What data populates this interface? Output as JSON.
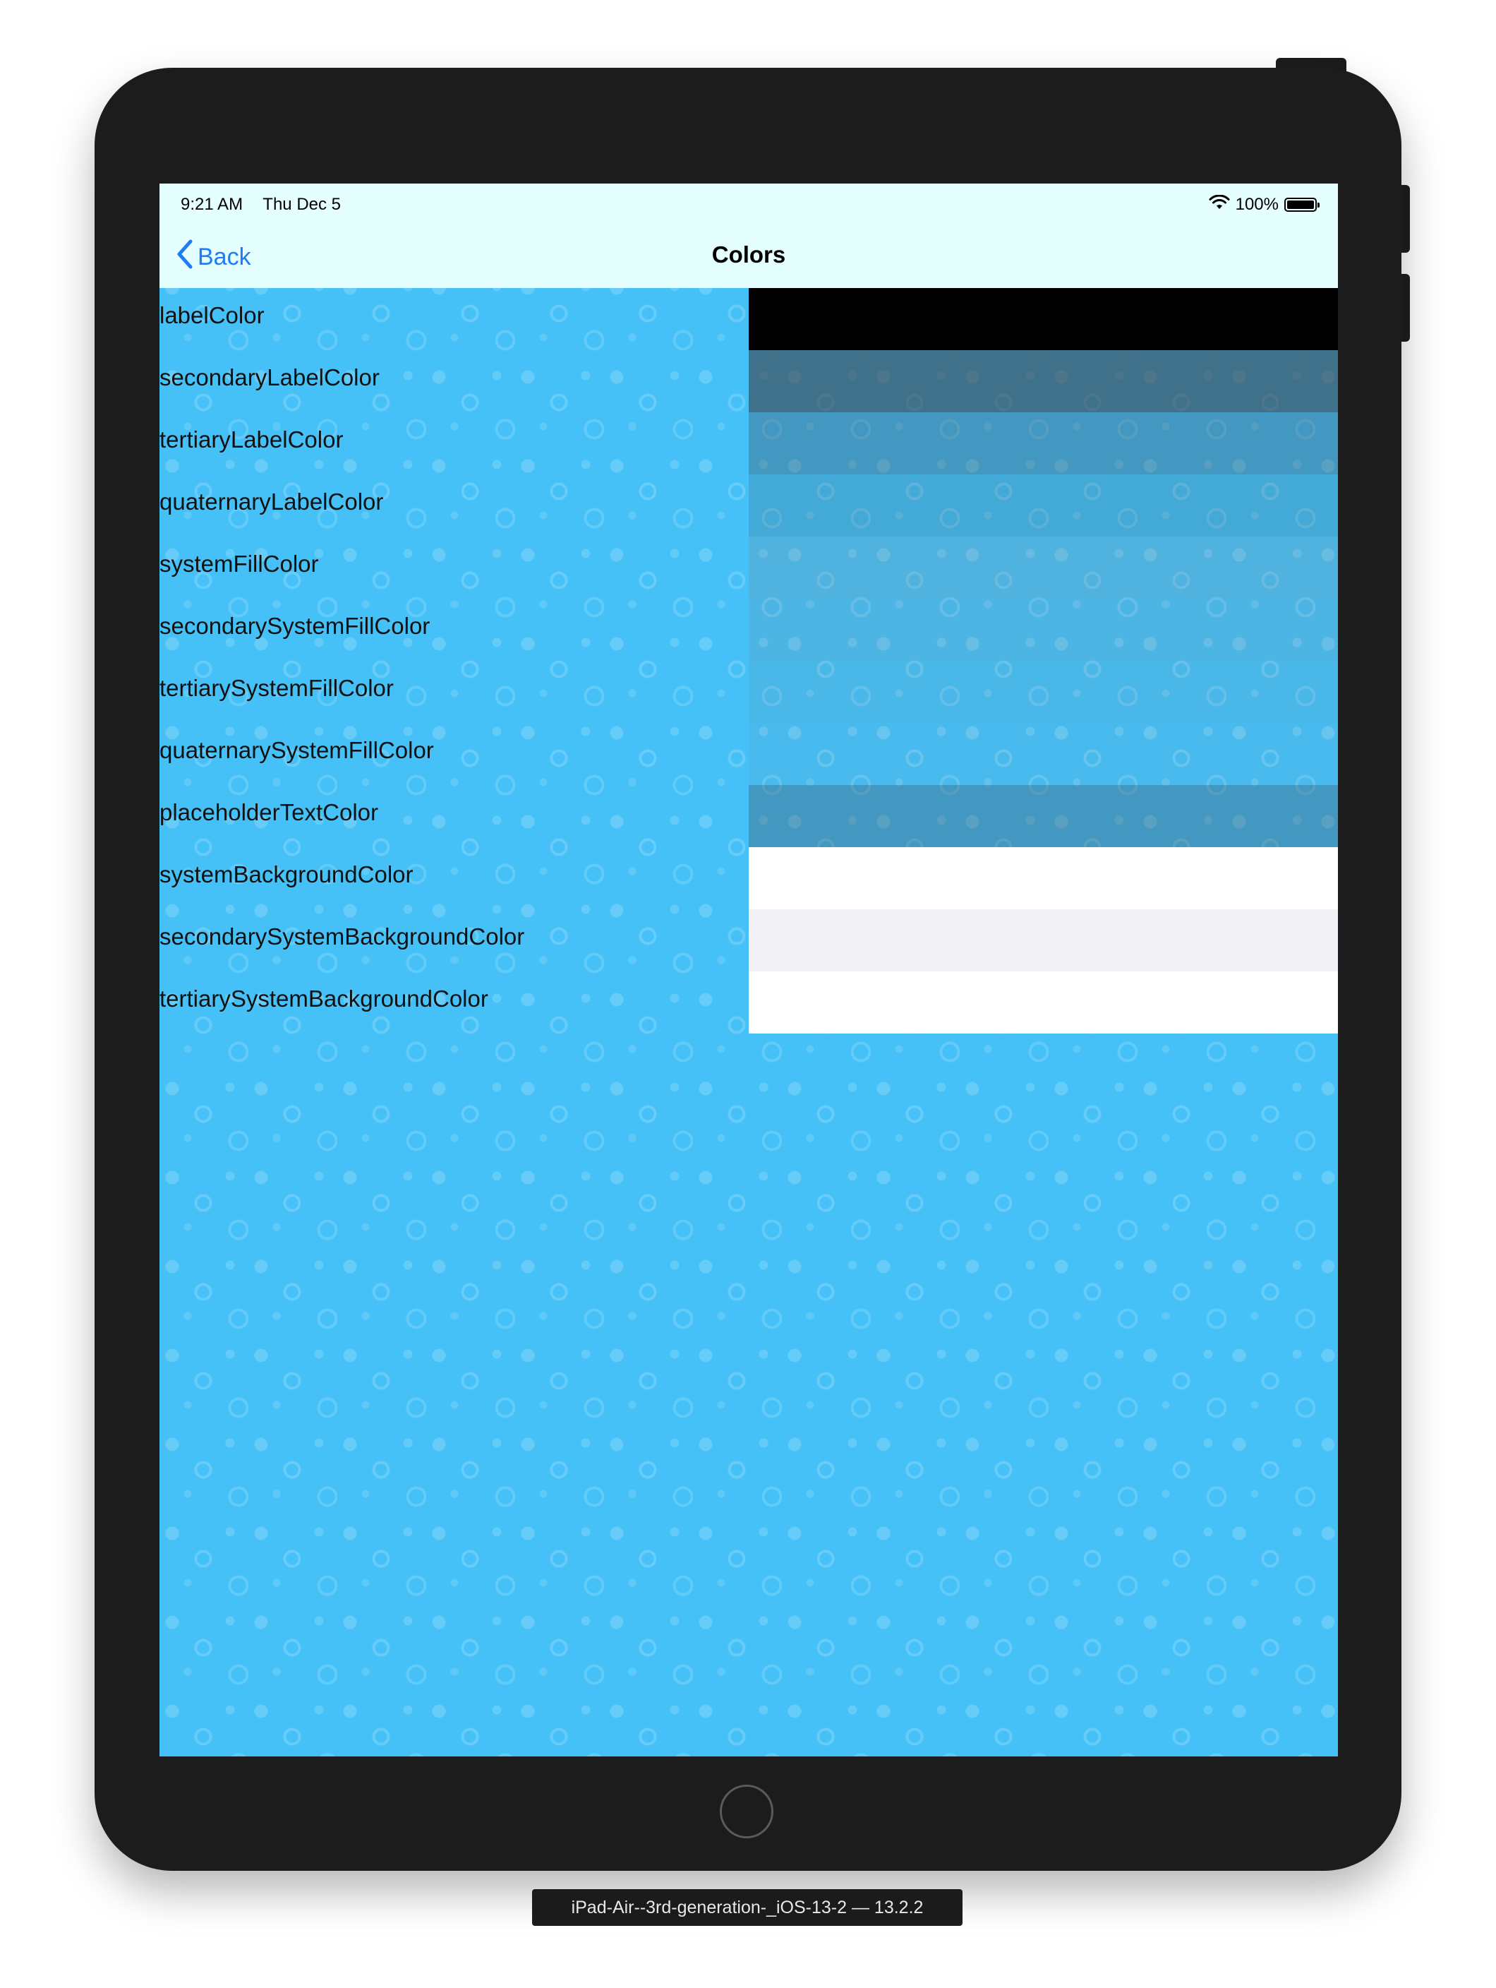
{
  "status_bar": {
    "time": "9:21 AM",
    "date": "Thu Dec 5",
    "battery_percent": "100%"
  },
  "nav": {
    "back_label": "Back",
    "title": "Colors"
  },
  "rows": [
    {
      "label": "labelColor",
      "swatch_color": "#000000"
    },
    {
      "label": "secondaryLabelColor",
      "swatch_color": "rgba(60,60,67,0.60)"
    },
    {
      "label": "tertiaryLabelColor",
      "swatch_color": "rgba(60,60,67,0.30)"
    },
    {
      "label": "quaternaryLabelColor",
      "swatch_color": "rgba(60,60,67,0.18)"
    },
    {
      "label": "systemFillColor",
      "swatch_color": "rgba(120,120,128,0.20)"
    },
    {
      "label": "secondarySystemFillColor",
      "swatch_color": "rgba(120,120,128,0.16)"
    },
    {
      "label": "tertiarySystemFillColor",
      "swatch_color": "rgba(118,118,128,0.12)"
    },
    {
      "label": "quaternarySystemFillColor",
      "swatch_color": "rgba(116,116,128,0.08)"
    },
    {
      "label": "placeholderTextColor",
      "swatch_color": "rgba(60,60,67,0.30)"
    },
    {
      "label": "systemBackgroundColor",
      "swatch_color": "#ffffff"
    },
    {
      "label": "secondarySystemBackgroundColor",
      "swatch_color": "#f2f2f7"
    },
    {
      "label": "tertiarySystemBackgroundColor",
      "swatch_color": "#ffffff"
    }
  ],
  "device_caption": "iPad-Air--3rd-generation-_iOS-13-2 — 13.2.2",
  "colors": {
    "bar_background": "#e5fefe",
    "tint": "#1f7cf4",
    "pattern_background": "#45c1f7",
    "device_body": "#1c1c1c"
  }
}
